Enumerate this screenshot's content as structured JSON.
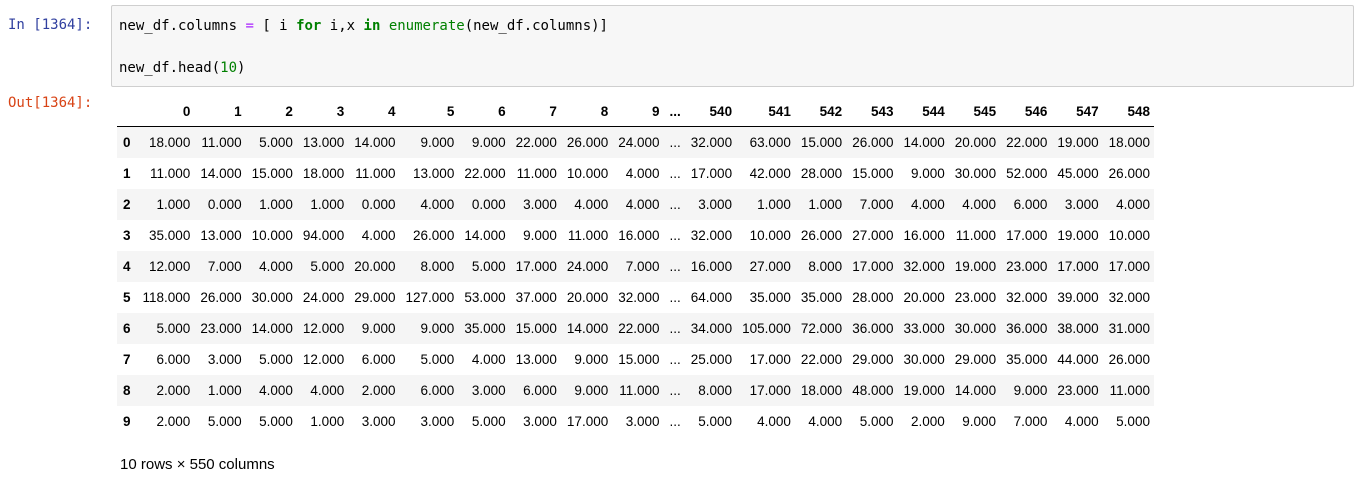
{
  "cell": {
    "in_prompt": "In [1364]:",
    "out_prompt": "Out[1364]:",
    "code": {
      "l1_a": "new_df.columns",
      "l1_eq": "=",
      "l1_b": "[ i",
      "l1_for": "for",
      "l1_c": "i,x",
      "l1_in": "in",
      "l1_enum": "enumerate",
      "l1_d": "(new_df.columns)]",
      "l2_a": "new_df.head(",
      "l2_num": "10",
      "l2_b": ")"
    }
  },
  "dataframe": {
    "columns": [
      "0",
      "1",
      "2",
      "3",
      "4",
      "5",
      "6",
      "7",
      "8",
      "9",
      "...",
      "540",
      "541",
      "542",
      "543",
      "544",
      "545",
      "546",
      "547",
      "548"
    ],
    "rows": [
      {
        "index": "0",
        "cells": [
          "18.000",
          "11.000",
          "5.000",
          "13.000",
          "14.000",
          "9.000",
          "9.000",
          "22.000",
          "26.000",
          "24.000",
          "...",
          "32.000",
          "63.000",
          "15.000",
          "26.000",
          "14.000",
          "20.000",
          "22.000",
          "19.000",
          "18.000"
        ]
      },
      {
        "index": "1",
        "cells": [
          "11.000",
          "14.000",
          "15.000",
          "18.000",
          "11.000",
          "13.000",
          "22.000",
          "11.000",
          "10.000",
          "4.000",
          "...",
          "17.000",
          "42.000",
          "28.000",
          "15.000",
          "9.000",
          "30.000",
          "52.000",
          "45.000",
          "26.000"
        ]
      },
      {
        "index": "2",
        "cells": [
          "1.000",
          "0.000",
          "1.000",
          "1.000",
          "0.000",
          "4.000",
          "0.000",
          "3.000",
          "4.000",
          "4.000",
          "...",
          "3.000",
          "1.000",
          "1.000",
          "7.000",
          "4.000",
          "4.000",
          "6.000",
          "3.000",
          "4.000"
        ]
      },
      {
        "index": "3",
        "cells": [
          "35.000",
          "13.000",
          "10.000",
          "94.000",
          "4.000",
          "26.000",
          "14.000",
          "9.000",
          "11.000",
          "16.000",
          "...",
          "32.000",
          "10.000",
          "26.000",
          "27.000",
          "16.000",
          "11.000",
          "17.000",
          "19.000",
          "10.000"
        ]
      },
      {
        "index": "4",
        "cells": [
          "12.000",
          "7.000",
          "4.000",
          "5.000",
          "20.000",
          "8.000",
          "5.000",
          "17.000",
          "24.000",
          "7.000",
          "...",
          "16.000",
          "27.000",
          "8.000",
          "17.000",
          "32.000",
          "19.000",
          "23.000",
          "17.000",
          "17.000"
        ]
      },
      {
        "index": "5",
        "cells": [
          "118.000",
          "26.000",
          "30.000",
          "24.000",
          "29.000",
          "127.000",
          "53.000",
          "37.000",
          "20.000",
          "32.000",
          "...",
          "64.000",
          "35.000",
          "35.000",
          "28.000",
          "20.000",
          "23.000",
          "32.000",
          "39.000",
          "32.000"
        ]
      },
      {
        "index": "6",
        "cells": [
          "5.000",
          "23.000",
          "14.000",
          "12.000",
          "9.000",
          "9.000",
          "35.000",
          "15.000",
          "14.000",
          "22.000",
          "...",
          "34.000",
          "105.000",
          "72.000",
          "36.000",
          "33.000",
          "30.000",
          "36.000",
          "38.000",
          "31.000"
        ]
      },
      {
        "index": "7",
        "cells": [
          "6.000",
          "3.000",
          "5.000",
          "12.000",
          "6.000",
          "5.000",
          "4.000",
          "13.000",
          "9.000",
          "15.000",
          "...",
          "25.000",
          "17.000",
          "22.000",
          "29.000",
          "30.000",
          "29.000",
          "35.000",
          "44.000",
          "26.000"
        ]
      },
      {
        "index": "8",
        "cells": [
          "2.000",
          "1.000",
          "4.000",
          "4.000",
          "2.000",
          "6.000",
          "3.000",
          "6.000",
          "9.000",
          "11.000",
          "...",
          "8.000",
          "17.000",
          "18.000",
          "48.000",
          "19.000",
          "14.000",
          "9.000",
          "23.000",
          "11.000"
        ]
      },
      {
        "index": "9",
        "cells": [
          "2.000",
          "5.000",
          "5.000",
          "1.000",
          "3.000",
          "3.000",
          "5.000",
          "3.000",
          "17.000",
          "3.000",
          "...",
          "5.000",
          "4.000",
          "4.000",
          "5.000",
          "2.000",
          "9.000",
          "7.000",
          "4.000",
          "5.000"
        ]
      }
    ],
    "shape_text": "10 rows × 550 columns"
  }
}
